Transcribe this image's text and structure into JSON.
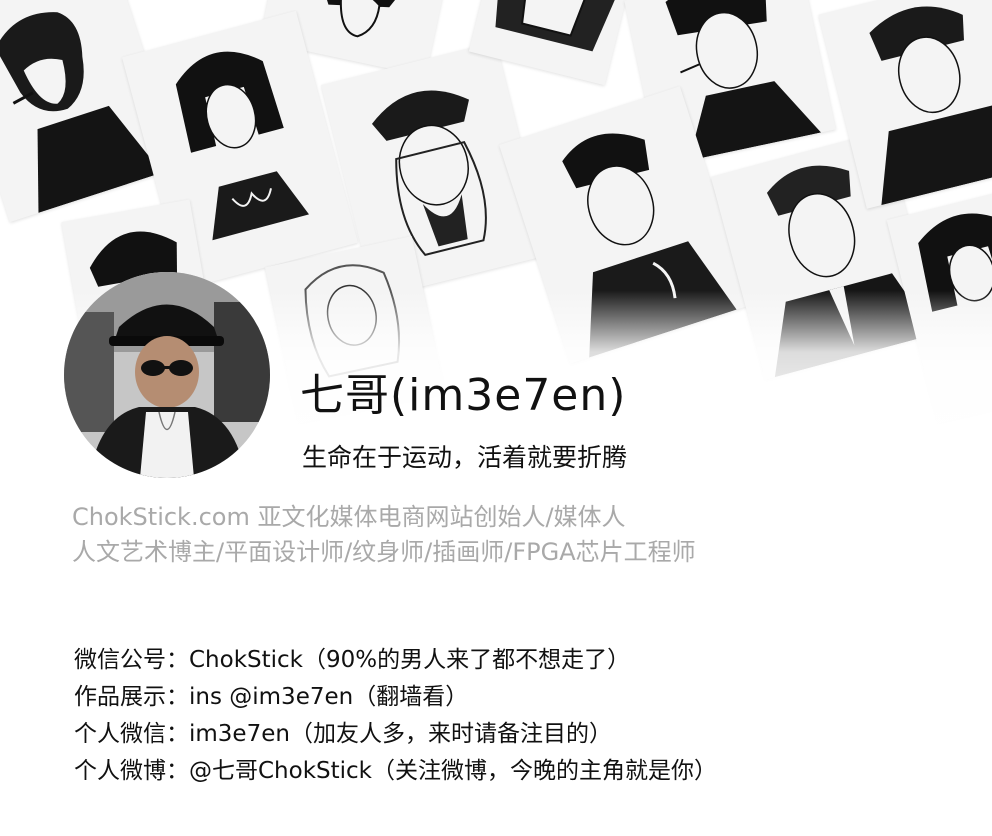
{
  "profile": {
    "name": "七哥(im3e7en)",
    "tagline": "生命在于运动，活着就要折腾"
  },
  "bio": {
    "line1": "ChokStick.com 亚文化媒体电商网站创始人/媒体人",
    "line2": "人文艺术博主/平面设计师/纹身师/插画师/FPGA芯片工程师"
  },
  "contacts": [
    {
      "label": "微信公号：",
      "value": "ChokStick",
      "note": "（90%的男人来了都不想走了）"
    },
    {
      "label": "作品展示：",
      "value": "ins @im3e7en",
      "note": "（翻墙看）"
    },
    {
      "label": "个人微信：",
      "value": "im3e7en",
      "note": "（加友人多，来时请备注目的）"
    },
    {
      "label": "个人微博：",
      "value": "@七哥ChokStick",
      "note": "（关注微博，今晚的主角就是你）"
    }
  ],
  "colors": {
    "text": "#111111",
    "bio_text": "#a9a9a9",
    "background": "#ffffff"
  }
}
